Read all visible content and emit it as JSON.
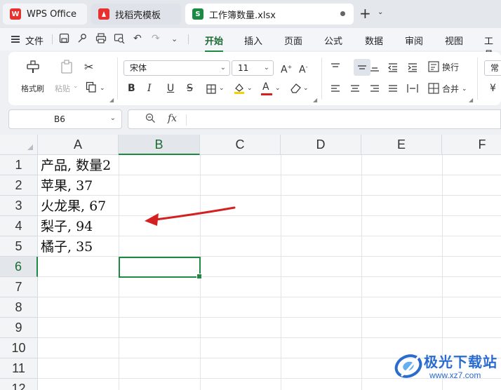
{
  "tabs": [
    {
      "label": "WPS Office",
      "icon": "wps-logo-icon",
      "icon_text": "W"
    },
    {
      "label": "找稻壳模板",
      "icon": "docer-logo-icon"
    },
    {
      "label": "工作簿数量.xlsx",
      "icon": "spreadsheet-icon",
      "icon_text": "S"
    }
  ],
  "menubar": {
    "file_label": "文件",
    "tabs": [
      "开始",
      "插入",
      "页面",
      "公式",
      "数据",
      "审阅",
      "视图",
      "工具"
    ],
    "active_tab": "开始"
  },
  "ribbon": {
    "format_painter": "格式刷",
    "paste": "粘贴",
    "font_name": "宋体",
    "font_size": "11",
    "bold": "B",
    "italic": "I",
    "underline": "U",
    "strike": "S",
    "font_color_letter": "A",
    "wrap_text": "换行",
    "merge": "合并",
    "number_format": "常"
  },
  "formula_bar": {
    "cell_ref": "B6",
    "fx": "fx",
    "value": ""
  },
  "sheet": {
    "columns": [
      "A",
      "B",
      "C",
      "D",
      "E",
      "F"
    ],
    "selected_column": "B",
    "rows": [
      "1",
      "2",
      "3",
      "4",
      "5",
      "6",
      "7",
      "8",
      "9",
      "10",
      "11",
      "12"
    ],
    "selected_row": "6",
    "cells_A": [
      "产品, 数量2",
      "苹果, 37",
      "火龙果, 67",
      "梨子, 94",
      "橘子, 35"
    ]
  },
  "watermark": {
    "title": "极光下载站",
    "url": "www.xz7.com"
  },
  "colors": {
    "accent_green": "#1d8a43",
    "arrow_red": "#d42020",
    "watermark_blue": "#2a6bd0"
  }
}
